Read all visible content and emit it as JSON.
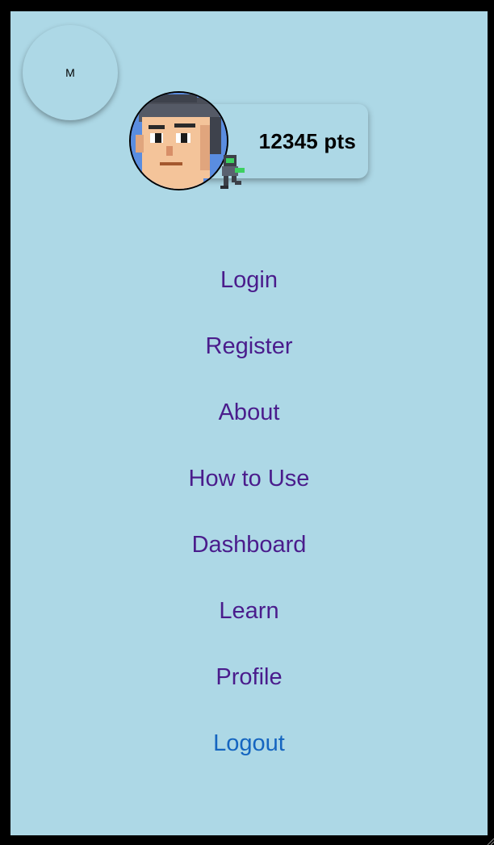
{
  "menu_toggle": {
    "label": "M"
  },
  "profile": {
    "points_text": "12345 pts",
    "avatar_icon": "pixel-art-face-avatar-icon",
    "sprite_icon": "pixel-robot-sprite-icon"
  },
  "nav": {
    "items": [
      {
        "label": "Login"
      },
      {
        "label": "Register"
      },
      {
        "label": "About"
      },
      {
        "label": "How to Use"
      },
      {
        "label": "Dashboard"
      },
      {
        "label": "Learn"
      },
      {
        "label": "Profile"
      },
      {
        "label": "Logout"
      }
    ]
  },
  "colors": {
    "background": "#add8e6",
    "frame": "#000000",
    "link": "#4a1c8c",
    "active_link": "#1565c0"
  }
}
